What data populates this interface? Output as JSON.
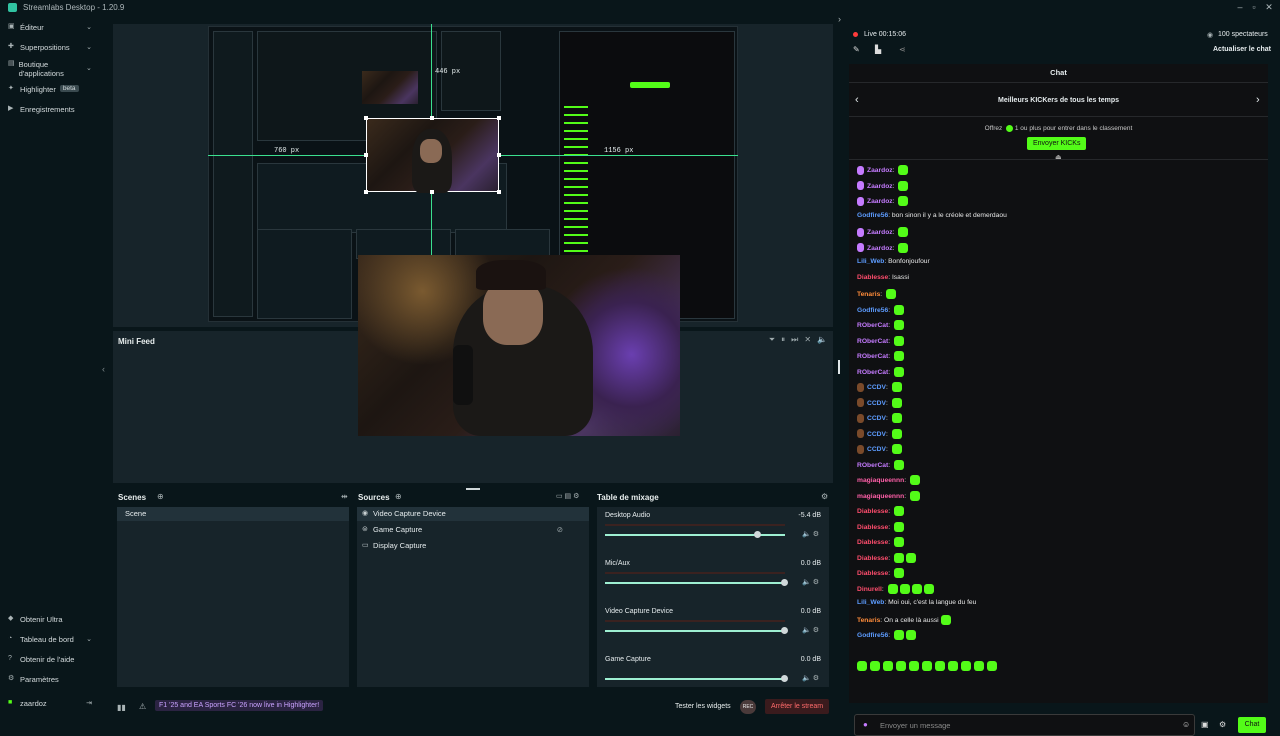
{
  "titlebar": {
    "title": "Streamlabs Desktop - 1.20.9"
  },
  "sidebar": {
    "items": [
      {
        "label": "Éditeur"
      },
      {
        "label": "Superpositions"
      },
      {
        "label": "Boutique d'applications"
      },
      {
        "label": "Highlighter",
        "badge": "beta"
      },
      {
        "label": "Enregistrements"
      }
    ],
    "bottom": [
      {
        "label": "Obtenir Ultra"
      },
      {
        "label": "Tableau de bord"
      },
      {
        "label": "Obtenir de l'aide"
      },
      {
        "label": "Paramètres"
      }
    ],
    "user": "zaardoz"
  },
  "preview": {
    "left_px": "760 px",
    "top_px": "446 px",
    "right_px": "1156 px"
  },
  "minifeed": {
    "title": "Mini Feed"
  },
  "scenes": {
    "title": "Scenes",
    "items": [
      "Scene"
    ]
  },
  "sources": {
    "title": "Sources",
    "items": [
      "Video Capture Device",
      "Game Capture",
      "Display Capture"
    ]
  },
  "mixer": {
    "title": "Table de mixage",
    "channels": [
      {
        "name": "Desktop Audio",
        "db": "-5.4 dB",
        "level": 0.85
      },
      {
        "name": "Mic/Aux",
        "db": "0.0 dB",
        "level": 1.0
      },
      {
        "name": "Video Capture Device",
        "db": "0.0 dB",
        "level": 1.0
      },
      {
        "name": "Game Capture",
        "db": "0.0 dB",
        "level": 1.0
      }
    ]
  },
  "status": {
    "notification": "F1 '25 and EA Sports FC '26 now live in Highlighter!",
    "widgets": "Tester les widgets",
    "rec": "REC",
    "stop": "Arrêter le stream"
  },
  "chat": {
    "live": "Live 00:15:06",
    "viewers": "100 spectateurs",
    "refresh": "Actualiser le chat",
    "title": "Chat",
    "leaderboard": "Meilleurs KICKers de tous les temps",
    "offer": "Offrez",
    "offer_rest": "1 ou plus pour entrer dans le classement",
    "send_kicks": "Envoyer KICKs",
    "placeholder": "Envoyer un message",
    "send": "Chat",
    "colors": {
      "green": "#53fc18",
      "purple": "#c57bff",
      "blue": "#5d9cff",
      "red": "#ff4d6d",
      "orange": "#ff8c3a",
      "pink": "#ff5fa8"
    },
    "messages": [
      {
        "user": "Zaardoz",
        "color": "#c57bff",
        "text": "",
        "emotes": 1
      },
      {
        "user": "Zaardoz",
        "color": "#c57bff",
        "text": "",
        "emotes": 1
      },
      {
        "user": "Zaardoz",
        "color": "#c57bff",
        "text": "",
        "emotes": 1
      },
      {
        "user": "Godfire56",
        "color": "#5d9cff",
        "text": "bon sinon il y a le créole et demerdaou",
        "emotes": 0
      },
      {
        "user": "Zaardoz",
        "color": "#c57bff",
        "text": "",
        "emotes": 1
      },
      {
        "user": "Zaardoz",
        "color": "#c57bff",
        "text": "",
        "emotes": 1
      },
      {
        "user": "Lili_Web",
        "color": "#5d9cff",
        "text": "Bonfonjoufour",
        "emotes": 0
      },
      {
        "user": "Diablesse",
        "color": "#ff4d6d",
        "text": "Isassi",
        "emotes": 0
      },
      {
        "user": "Tenaris",
        "color": "#ff8c3a",
        "text": "",
        "emotes": 1
      },
      {
        "user": "Godfire56",
        "color": "#5d9cff",
        "text": "",
        "emotes": 1
      },
      {
        "user": "RОberCat",
        "color": "#c57bff",
        "text": "",
        "emotes": 1
      },
      {
        "user": "RОberCat",
        "color": "#c57bff",
        "text": "",
        "emotes": 1
      },
      {
        "user": "RОberCat",
        "color": "#c57bff",
        "text": "",
        "emotes": 1
      },
      {
        "user": "RОberCat",
        "color": "#c57bff",
        "text": "",
        "emotes": 1
      },
      {
        "user": "CCDV",
        "color": "#5d9cff",
        "text": "",
        "emotes": 1
      },
      {
        "user": "CCDV",
        "color": "#5d9cff",
        "text": "",
        "emotes": 1
      },
      {
        "user": "CCDV",
        "color": "#5d9cff",
        "text": "",
        "emotes": 1
      },
      {
        "user": "CCDV",
        "color": "#5d9cff",
        "text": "",
        "emotes": 1
      },
      {
        "user": "CCDV",
        "color": "#5d9cff",
        "text": "",
        "emotes": 1
      },
      {
        "user": "RОberCat",
        "color": "#c57bff",
        "text": "",
        "emotes": 1
      },
      {
        "user": "magiaqueennn",
        "color": "#ff5fa8",
        "text": "",
        "emotes": 1
      },
      {
        "user": "magiaqueennn",
        "color": "#ff5fa8",
        "text": "",
        "emotes": 1
      },
      {
        "user": "Diablesse",
        "color": "#ff4d6d",
        "text": "",
        "emotes": 1
      },
      {
        "user": "Diablesse",
        "color": "#ff4d6d",
        "text": "",
        "emotes": 1
      },
      {
        "user": "Diablesse",
        "color": "#ff4d6d",
        "text": "",
        "emotes": 1
      },
      {
        "user": "Diablesse",
        "color": "#ff4d6d",
        "text": "",
        "emotes": 2
      },
      {
        "user": "Diablesse",
        "color": "#ff4d6d",
        "text": "",
        "emotes": 1
      },
      {
        "user": "Dinurell",
        "color": "#ff4d6d",
        "text": "",
        "emotes": 4
      },
      {
        "user": "Lili_Web",
        "color": "#5d9cff",
        "text": "Moi oui, c'est la langue du feu",
        "emotes": 0
      },
      {
        "user": "Tenaris",
        "color": "#ff8c3a",
        "text": "On a celle là aussi",
        "emotes": 1
      },
      {
        "user": "Godfire56",
        "color": "#5d9cff",
        "text": "",
        "emotes": 2
      }
    ]
  }
}
